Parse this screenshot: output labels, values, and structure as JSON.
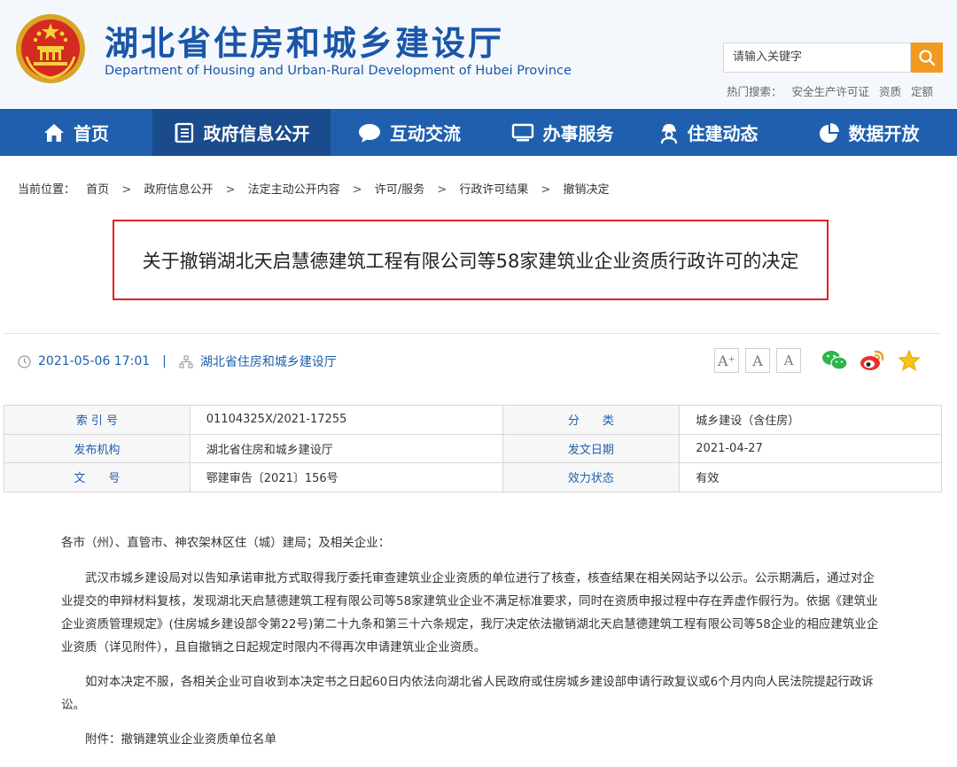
{
  "header": {
    "title": "湖北省住房和城乡建设厅",
    "subtitle": "Department of Housing and Urban-Rural Development of Hubei Province",
    "search_placeholder": "请输入关键字",
    "hot_search_label": "热门搜索：",
    "hot_search_items": [
      "安全生产许可证",
      "资质",
      "定额"
    ]
  },
  "nav": {
    "items": [
      {
        "label": "首页",
        "icon": "home-icon"
      },
      {
        "label": "政府信息公开",
        "icon": "document-list-icon",
        "active": true
      },
      {
        "label": "互动交流",
        "icon": "chat-bubble-icon"
      },
      {
        "label": "办事服务",
        "icon": "monitor-icon"
      },
      {
        "label": "住建动态",
        "icon": "worker-icon"
      },
      {
        "label": "数据开放",
        "icon": "pie-chart-icon"
      }
    ]
  },
  "breadcrumb": {
    "prefix": "当前位置：",
    "items": [
      "首页",
      "政府信息公开",
      "法定主动公开内容",
      "许可/服务",
      "行政许可结果",
      "撤销决定"
    ],
    "separator": ">"
  },
  "article": {
    "title": "关于撤销湖北天启慧德建筑工程有限公司等58家建筑业企业资质行政许可的决定",
    "datetime": "2021-05-06 17:01",
    "pipe": "|",
    "publisher": "湖北省住房和城乡建设厅"
  },
  "font_size_buttons": [
    "A⁺",
    "A",
    "A"
  ],
  "share": [
    "wechat-icon",
    "weibo-icon",
    "favorite-star-icon"
  ],
  "info_table": {
    "rows": [
      {
        "label1": "索 引 号",
        "value1": "01104325X/2021-17255",
        "label2": "分　　类",
        "value2": "城乡建设（含住房）"
      },
      {
        "label1": "发布机构",
        "value1": "湖北省住房和城乡建设厅",
        "label2": "发文日期",
        "value2": "2021-04-27"
      },
      {
        "label1": "文　　号",
        "value1": "鄂建审告〔2021〕156号",
        "label2": "效力状态",
        "value2": "有效"
      }
    ]
  },
  "content": {
    "salutation": "各市（州）、直管市、神农架林区住（城）建局；及相关企业：",
    "para1": "武汉市城乡建设局对以告知承诺审批方式取得我厅委托审查建筑业企业资质的单位进行了核查，核查结果在相关网站予以公示。公示期满后，通过对企业提交的申辩材料复核，发现湖北天启慧德建筑工程有限公司等58家建筑业企业不满足标准要求，同时在资质申报过程中存在弄虚作假行为。依据《建筑业企业资质管理规定》(住房城乡建设部令第22号)第二十九条和第三十六条规定，我厅决定依法撤销湖北天启慧德建筑工程有限公司等58企业的相应建筑业企业资质（详见附件），且自撤销之日起规定时限内不得再次申请建筑业企业资质。",
    "para2": "如对本决定不服，各相关企业可自收到本决定书之日起60日内依法向湖北省人民政府或住房城乡建设部申请行政复议或6个月内向人民法院提起行政诉讼。",
    "attachment": "附件：撤销建筑业企业资质单位名单"
  },
  "colors": {
    "brand_blue": "#1f5fae",
    "nav_active": "#1a4b8c",
    "search_orange": "#f29a1f",
    "highlight_red": "#e02222"
  }
}
